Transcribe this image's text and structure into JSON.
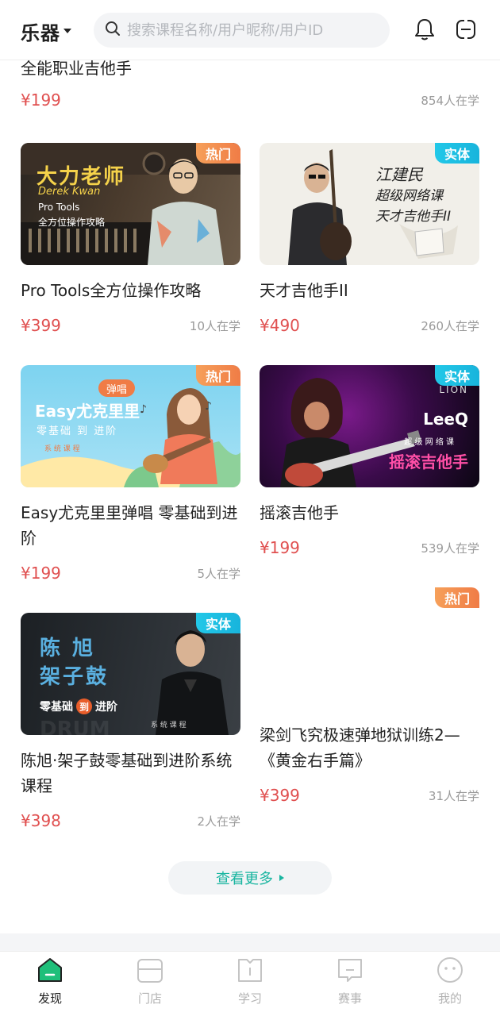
{
  "header": {
    "category": "乐器",
    "search_placeholder": "搜索课程名称/用户昵称/用户ID",
    "icons": [
      "bell-icon",
      "scan-icon"
    ]
  },
  "partial_card": {
    "title": "全能职业吉他手",
    "price": "¥199",
    "learners": "854人在学"
  },
  "courses": [
    {
      "title": "Pro Tools全方位操作攻略",
      "price": "¥399",
      "learners": "10人在学",
      "badge": "热门",
      "thumb_text": [
        "大力老师",
        "Derek Kwan",
        "Pro Tools",
        "全方位操作攻略"
      ]
    },
    {
      "title": "天才吉他手II",
      "price": "¥490",
      "learners": "260人在学",
      "badge": "实体",
      "thumb_text": [
        "江建民",
        "超级网络课",
        "天才吉他手II"
      ]
    },
    {
      "title": "Easy尤克里里弹唱 零基础到进阶",
      "price": "¥199",
      "learners": "5人在学",
      "badge": "热门",
      "thumb_text": [
        "弹唱",
        "Easy尤克里里",
        "零基础 到 进阶",
        "系 统 课 程"
      ]
    },
    {
      "title": "摇滚吉他手",
      "price": "¥199",
      "learners": "539人在学",
      "badge": "实体",
      "thumb_text": [
        "LION",
        "LeeQ",
        "超 级 网 络 课",
        "摇滚吉他手"
      ]
    },
    {
      "title": "陈旭·架子鼓零基础到进阶系统课程",
      "price": "¥398",
      "learners": "2人在学",
      "badge": "实体",
      "thumb_text": [
        "陈  旭",
        "架子鼓",
        "零基础",
        "到",
        "进阶",
        "系 统 课 程",
        "DRUM"
      ]
    },
    {
      "title": "梁剑飞究极速弹地狱训练2—《黄金右手篇》",
      "price": "¥399",
      "learners": "31人在学",
      "badge": "热门"
    }
  ],
  "more_button": "查看更多",
  "tabbar": [
    {
      "label": "发现",
      "icon": "discover-icon",
      "active": true
    },
    {
      "label": "门店",
      "icon": "store-icon",
      "active": false
    },
    {
      "label": "学习",
      "icon": "book-icon",
      "active": false
    },
    {
      "label": "赛事",
      "icon": "contest-icon",
      "active": false
    },
    {
      "label": "我的",
      "icon": "profile-icon",
      "active": false
    }
  ],
  "colors": {
    "price": "#e05050",
    "accent": "#19b5a0",
    "badge_hot": "#f07c46",
    "badge_real": "#18b4dc"
  }
}
